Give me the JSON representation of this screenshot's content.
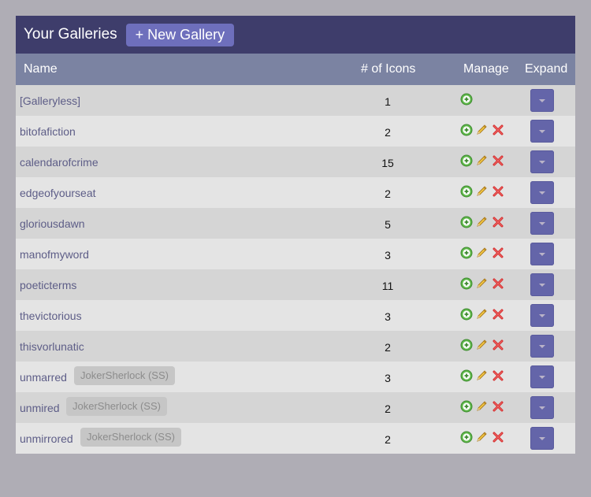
{
  "header": {
    "title": "Your Galleries",
    "new_gallery_label": "+ New Gallery"
  },
  "columns": {
    "name": "Name",
    "count": "# of Icons",
    "manage": "Manage",
    "expand": "Expand"
  },
  "rows": [
    {
      "name": "[Galleryless]",
      "count": "1",
      "tag": "",
      "editable": false
    },
    {
      "name": "bitofafiction",
      "count": "2",
      "tag": "",
      "editable": true
    },
    {
      "name": "calendarofcrime",
      "count": "15",
      "tag": "",
      "editable": true
    },
    {
      "name": "edgeofyourseat",
      "count": "2",
      "tag": "",
      "editable": true
    },
    {
      "name": "gloriousdawn",
      "count": "5",
      "tag": "",
      "editable": true
    },
    {
      "name": "manofmyword",
      "count": "3",
      "tag": "",
      "editable": true
    },
    {
      "name": "poeticterms",
      "count": "11",
      "tag": "",
      "editable": true
    },
    {
      "name": "thevictorious",
      "count": "3",
      "tag": "",
      "editable": true
    },
    {
      "name": "thisvorlunatic",
      "count": "2",
      "tag": "",
      "editable": true
    },
    {
      "name": "unmarred",
      "count": "3",
      "tag": "JokerSherlock (SS)",
      "editable": true
    },
    {
      "name": "unmired",
      "count": "2",
      "tag": "JokerSherlock (SS)",
      "editable": true
    },
    {
      "name": "unmirrored",
      "count": "2",
      "tag": "JokerSherlock (SS)",
      "editable": true
    }
  ],
  "icons": {
    "add": "add-icon",
    "edit": "pencil-icon",
    "delete": "delete-icon",
    "expand": "caret-down-icon"
  },
  "colors": {
    "topbar": "#3e3d6b",
    "header_row": "#7b83a2",
    "button": "#6e6fbc",
    "link": "#5d5d87"
  }
}
